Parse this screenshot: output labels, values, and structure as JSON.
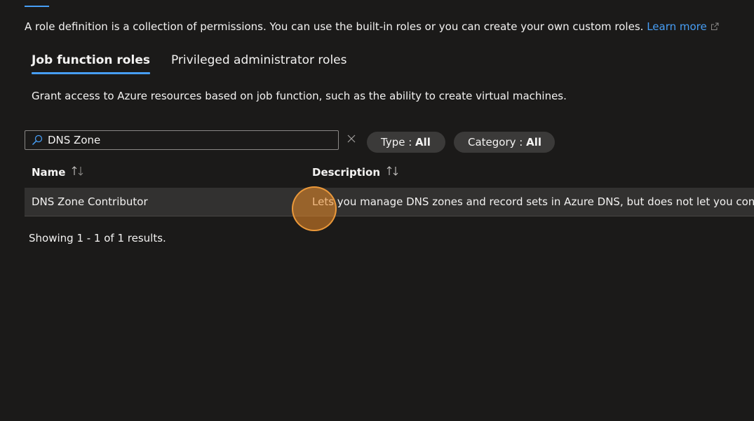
{
  "intro": {
    "text": "A role definition is a collection of permissions. You can use the built-in roles or you can create your own custom roles.",
    "learn_more": "Learn more"
  },
  "tabs": [
    {
      "label": "Job function roles",
      "active": true
    },
    {
      "label": "Privileged administrator roles",
      "active": false
    }
  ],
  "tab_description": "Grant access to Azure resources based on job function, such as the ability to create virtual machines.",
  "search": {
    "value": "DNS Zone",
    "placeholder": ""
  },
  "filters": {
    "type_label": "Type : ",
    "type_value": "All",
    "category_label": "Category : ",
    "category_value": "All"
  },
  "table": {
    "columns": [
      "Name",
      "Description"
    ],
    "rows": [
      {
        "name": "DNS Zone Contributor",
        "description": "Lets you manage DNS zones and record sets in Azure DNS, but does not let you control"
      }
    ]
  },
  "results_text": "Showing 1 - 1 of 1 results.",
  "colors": {
    "background": "#1b1a19",
    "accent": "#479ef5",
    "row_bg": "#323130",
    "pill_bg": "#3b3a39",
    "click_marker": "#ec8c28"
  },
  "icons": {
    "search": "search-icon",
    "external_link": "external-link-icon",
    "clear": "close-icon",
    "sort": "sort-icon"
  }
}
